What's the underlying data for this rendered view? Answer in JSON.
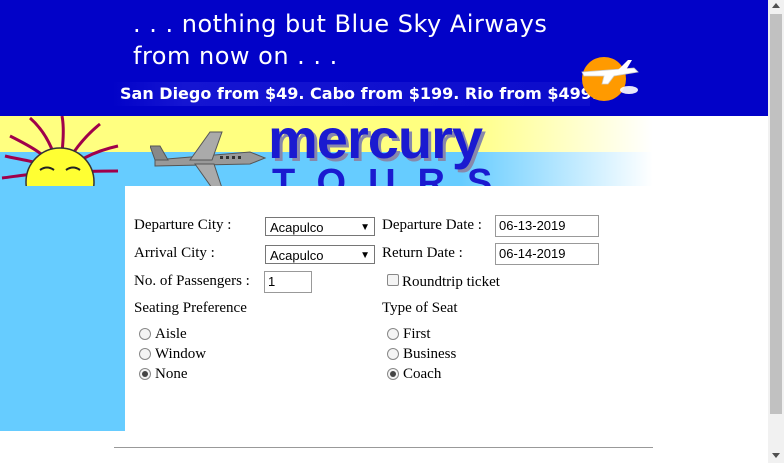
{
  "banner": {
    "line1": ". . . nothing but Blue Sky Airways",
    "line2": "from now on . . .",
    "promo": "San Diego from $49. Cabo from $199. Rio from $499.",
    "logo_icon": "orange-sun-airplane-logo-icon"
  },
  "header": {
    "brand": "mercury",
    "brand_sub": "TOURS",
    "sun_icon": "sun-icon",
    "plane_icon": "airplane-icon"
  },
  "form": {
    "departure_city": {
      "label": "Departure City :",
      "value": "Acapulco"
    },
    "departure_date": {
      "label": "Departure Date :",
      "value": "06-13-2019"
    },
    "arrival_city": {
      "label": "Arrival City :",
      "value": "Acapulco"
    },
    "return_date": {
      "label": "Return Date :",
      "value": "06-14-2019"
    },
    "passengers": {
      "label": "No. of Passengers :",
      "value": "1"
    },
    "roundtrip": {
      "label": "Roundtrip ticket",
      "checked": false
    },
    "seating": {
      "label": "Seating Preference",
      "options": [
        "Aisle",
        "Window",
        "None"
      ],
      "selected": "None"
    },
    "seat_type": {
      "label": "Type of Seat",
      "options": [
        "First",
        "Business",
        "Coach"
      ],
      "selected": "Coach"
    }
  },
  "colors": {
    "banner_bg": "#0202c8",
    "sidebar_bg": "#66ccff",
    "brand_text": "#1a1ad0"
  }
}
